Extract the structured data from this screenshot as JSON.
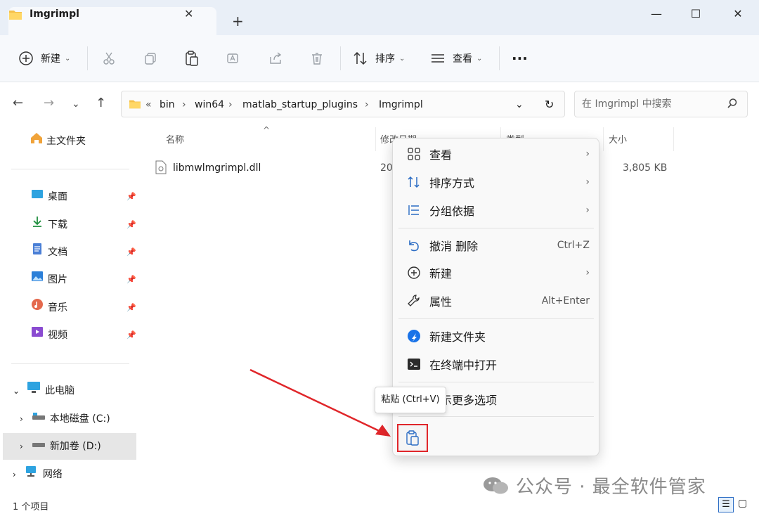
{
  "window": {
    "tab_title": "Imgrimpl",
    "new_tab": "+"
  },
  "toolbar": {
    "new_label": "新建",
    "sort_label": "排序",
    "view_label": "查看",
    "more_label": "···"
  },
  "address": {
    "crumbs": [
      "bin",
      "win64",
      "matlab_startup_plugins",
      "Imgrimpl"
    ],
    "overflow": "«",
    "search_placeholder": "在 Imgrimpl 中搜索"
  },
  "sidebar": {
    "home": "主文件夹",
    "quick": [
      "桌面",
      "下载",
      "文档",
      "图片",
      "音乐",
      "视频"
    ],
    "this_pc": "此电脑",
    "drives": [
      "本地磁盘 (C:)",
      "新加卷 (D:)"
    ],
    "network": "网络"
  },
  "columns": {
    "name": "名称",
    "modified": "修改日期",
    "type": "类型",
    "size": "大小"
  },
  "files": [
    {
      "name": "libmwlmgrimpl.dll",
      "modified": "20",
      "size": "3,805 KB"
    }
  ],
  "context_menu": {
    "items": [
      {
        "label": "查看",
        "shortcut": "",
        "arrow": "›"
      },
      {
        "label": "排序方式",
        "shortcut": "",
        "arrow": "›"
      },
      {
        "label": "分组依据",
        "shortcut": "",
        "arrow": "›"
      },
      {
        "label": "撤消 删除",
        "shortcut": "Ctrl+Z",
        "arrow": ""
      },
      {
        "label": "新建",
        "shortcut": "",
        "arrow": "›"
      },
      {
        "label": "属性",
        "shortcut": "Alt+Enter",
        "arrow": ""
      },
      {
        "label": "新建文件夹",
        "shortcut": "",
        "arrow": ""
      },
      {
        "label": "在终端中打开",
        "shortcut": "",
        "arrow": ""
      },
      {
        "label": "显示更多选项",
        "shortcut": "",
        "arrow": ""
      }
    ],
    "tooltip": "粘贴 (Ctrl+V)"
  },
  "status": {
    "count": "1 个项目"
  },
  "watermark": "公众号 · 最全软件管家",
  "colors": {
    "accent": "#0067c0",
    "highlight_box": "#e0262a",
    "arrow": "#e0262a"
  }
}
